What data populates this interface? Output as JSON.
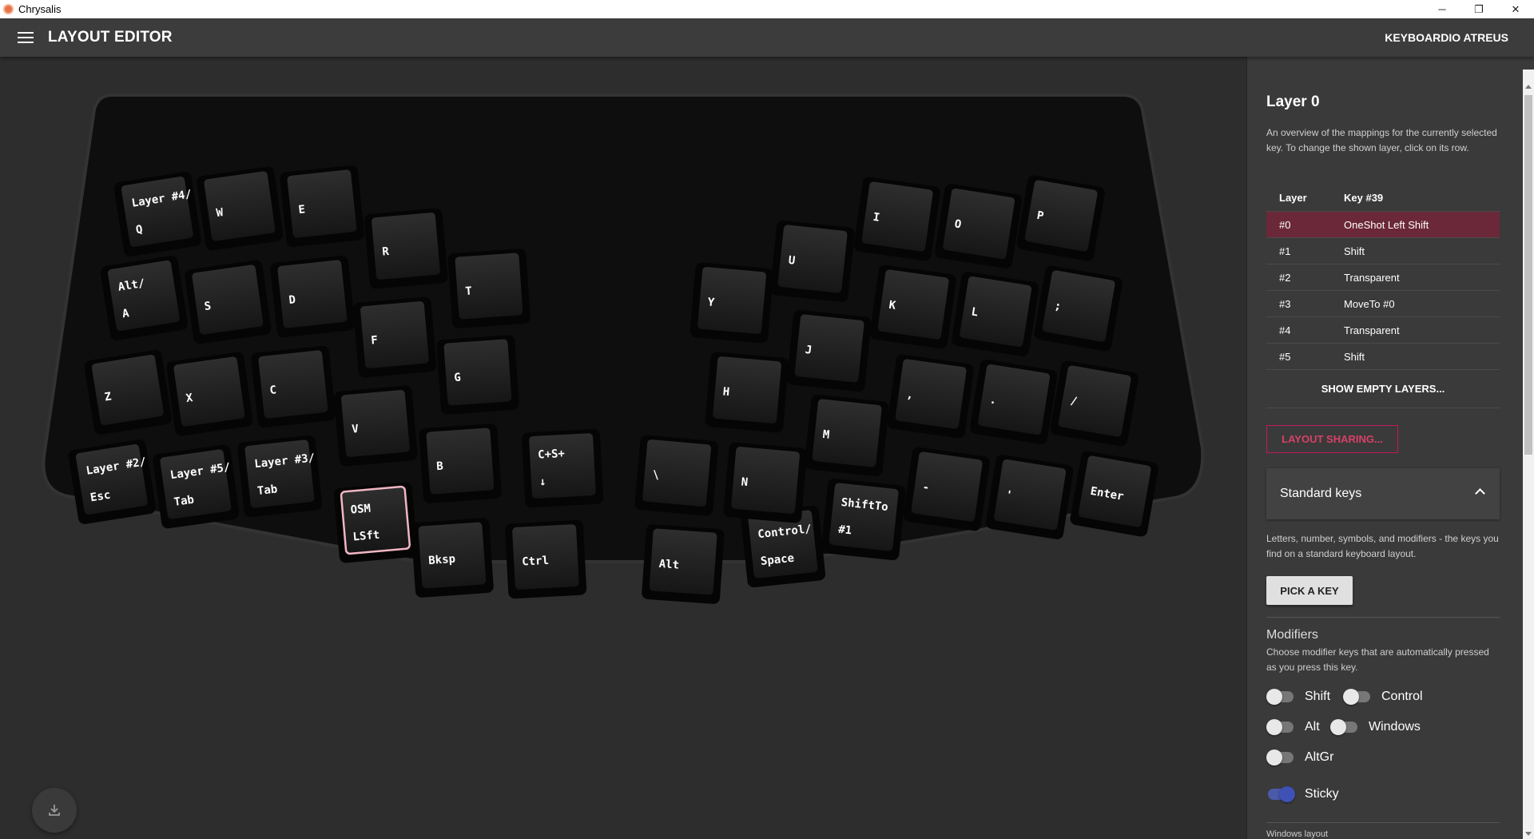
{
  "window": {
    "title": "Chrysalis",
    "minimize": "─",
    "maximize": "❐",
    "close": "✕"
  },
  "appbar": {
    "title": "LAYOUT EDITOR",
    "device": "KEYBOARDIO ATREUS"
  },
  "keyboard": {
    "keys": [
      {
        "id": "k-q",
        "top": "Layer #4/",
        "bottom": "Q"
      },
      {
        "id": "k-w",
        "top": "",
        "bottom": "W"
      },
      {
        "id": "k-e",
        "top": "",
        "bottom": "E"
      },
      {
        "id": "k-r",
        "top": "",
        "bottom": "R"
      },
      {
        "id": "k-t",
        "top": "",
        "bottom": "T"
      },
      {
        "id": "k-a",
        "top": "Alt/",
        "bottom": "A"
      },
      {
        "id": "k-s",
        "top": "",
        "bottom": "S"
      },
      {
        "id": "k-d",
        "top": "",
        "bottom": "D"
      },
      {
        "id": "k-f",
        "top": "",
        "bottom": "F"
      },
      {
        "id": "k-g",
        "top": "",
        "bottom": "G"
      },
      {
        "id": "k-z",
        "top": "",
        "bottom": "Z"
      },
      {
        "id": "k-x",
        "top": "",
        "bottom": "X"
      },
      {
        "id": "k-c",
        "top": "",
        "bottom": "C"
      },
      {
        "id": "k-v",
        "top": "",
        "bottom": "V"
      },
      {
        "id": "k-b",
        "top": "",
        "bottom": "B"
      },
      {
        "id": "k-esc",
        "top": "Layer #2/",
        "bottom": "Esc"
      },
      {
        "id": "k-tab",
        "top": "Layer #5/",
        "bottom": "Tab"
      },
      {
        "id": "k-tab3",
        "top": "Layer #3/",
        "bottom": "Tab"
      },
      {
        "id": "k-osm",
        "top": "OSM",
        "bottom": "LSft"
      },
      {
        "id": "k-bksp",
        "top": "",
        "bottom": "Bksp"
      },
      {
        "id": "k-ctrl",
        "top": "",
        "bottom": "Ctrl"
      },
      {
        "id": "k-cs",
        "top": "C+S+",
        "bottom": "↓"
      },
      {
        "id": "k-bslash",
        "top": "",
        "bottom": "\\"
      },
      {
        "id": "k-alt",
        "top": "",
        "bottom": "Alt"
      },
      {
        "id": "k-space",
        "top": "Control/",
        "bottom": "Space"
      },
      {
        "id": "k-y",
        "top": "",
        "bottom": "Y"
      },
      {
        "id": "k-u",
        "top": "",
        "bottom": "U"
      },
      {
        "id": "k-i",
        "top": "",
        "bottom": "I"
      },
      {
        "id": "k-o",
        "top": "",
        "bottom": "O"
      },
      {
        "id": "k-p",
        "top": "",
        "bottom": "P"
      },
      {
        "id": "k-h",
        "top": "",
        "bottom": "H"
      },
      {
        "id": "k-j",
        "top": "",
        "bottom": "J"
      },
      {
        "id": "k-k",
        "top": "",
        "bottom": "K"
      },
      {
        "id": "k-l",
        "top": "",
        "bottom": "L"
      },
      {
        "id": "k-semi",
        "top": "",
        "bottom": ";"
      },
      {
        "id": "k-n",
        "top": "",
        "bottom": "N"
      },
      {
        "id": "k-m",
        "top": "",
        "bottom": "M"
      },
      {
        "id": "k-comma",
        "top": "",
        "bottom": ","
      },
      {
        "id": "k-period",
        "top": "",
        "bottom": "."
      },
      {
        "id": "k-slash",
        "top": "",
        "bottom": "/"
      },
      {
        "id": "k-shiftto",
        "top": "ShiftTo",
        "bottom": "#1"
      },
      {
        "id": "k-minus",
        "top": "",
        "bottom": "-"
      },
      {
        "id": "k-quote",
        "top": "",
        "bottom": "'"
      },
      {
        "id": "k-enter",
        "top": "",
        "bottom": "Enter"
      }
    ]
  },
  "sidebar": {
    "layer_title": "Layer 0",
    "description": "An overview of the mappings for the currently selected key. To change the shown layer, click on its row.",
    "table": {
      "col_layer": "Layer",
      "col_key": "Key #39",
      "rows": [
        {
          "layer": "#0",
          "key": "OneShot Left Shift"
        },
        {
          "layer": "#1",
          "key": "Shift"
        },
        {
          "layer": "#2",
          "key": "Transparent"
        },
        {
          "layer": "#3",
          "key": "MoveTo #0"
        },
        {
          "layer": "#4",
          "key": "Transparent"
        },
        {
          "layer": "#5",
          "key": "Shift"
        }
      ],
      "show_empty": "SHOW EMPTY LAYERS..."
    },
    "layout_sharing": "LAYOUT SHARING...",
    "standard_keys": {
      "title": "Standard keys",
      "description": "Letters, number, symbols, and modifiers - the keys you find on a standard keyboard layout.",
      "pick_button": "PICK A KEY"
    },
    "modifiers": {
      "title": "Modifiers",
      "description": "Choose modifier keys that are automatically pressed as you press this key.",
      "shift": "Shift",
      "control": "Control",
      "alt": "Alt",
      "windows": "Windows",
      "altgr": "AltGr",
      "sticky": "Sticky"
    },
    "windows_layout": "Windows layout"
  },
  "colors": {
    "accent": "#c2185b",
    "selected_row": "#6b2838",
    "toggle_on": "#3f51b5",
    "selected_key_border": "#f2b6c3"
  }
}
